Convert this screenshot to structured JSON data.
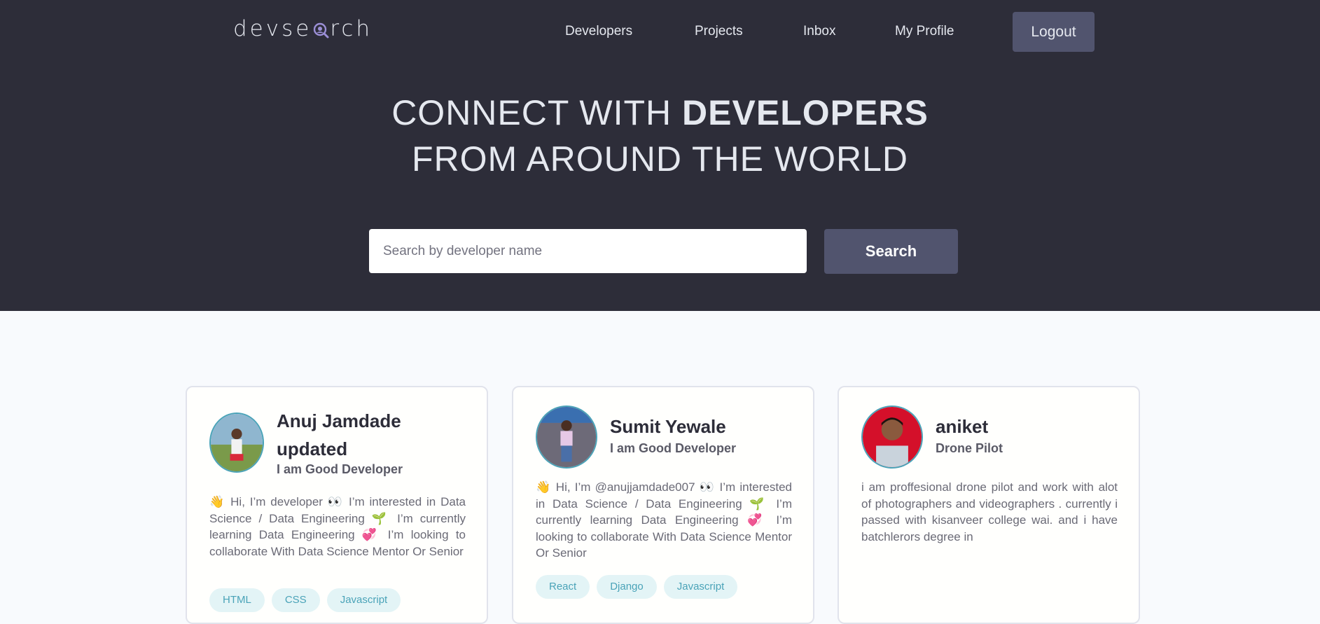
{
  "nav": {
    "logo_left": "devse",
    "logo_right": "rch",
    "links": [
      "Developers",
      "Projects",
      "Inbox",
      "My Profile"
    ],
    "logout_label": "Logout"
  },
  "hero": {
    "line1_light": "CONNECT WITH ",
    "line1_bold": "DEVELOPERS",
    "line2": "FROM AROUND THE WORLD"
  },
  "search": {
    "placeholder": "Search by developer name",
    "button_label": "Search"
  },
  "developers": [
    {
      "name": "Anuj Jamdade updated",
      "role": "I am Good Developer",
      "bio": "👋 Hi, I’m developer 👀 I’m interested in Data Science / Data Engineering 🌱 I’m currently learning Data Engineering 💞️ I’m looking to collaborate With Data Science Mentor Or Senior",
      "skills": [
        "HTML",
        "CSS",
        "Javascript"
      ]
    },
    {
      "name": "Sumit Yewale",
      "role": "I am Good Developer",
      "bio": "👋 Hi, I’m @anujjamdade007 👀 I’m interested in Data Science / Data Engineering 🌱 I’m currently learning Data Engineering 💞️ I’m looking to collaborate With Data Science Mentor Or Senior",
      "skills": [
        "React",
        "Django",
        "Javascript"
      ]
    },
    {
      "name": "aniket",
      "role": "Drone Pilot",
      "bio": "i am proffesional drone pilot and work with alot of photographers and videographers . currently i passed with kisanveer college wai. and i have batchlerors degree in",
      "skills": []
    }
  ]
}
